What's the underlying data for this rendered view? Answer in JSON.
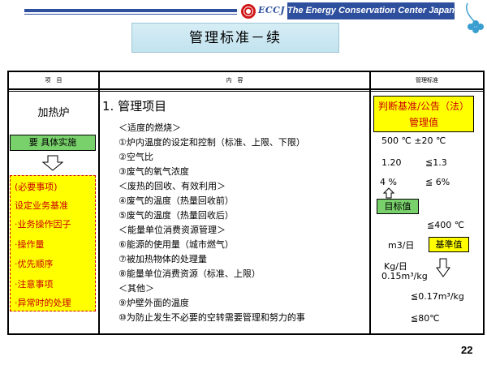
{
  "header": {
    "logo_text": "ECCJ",
    "org_name": "The Energy Conservation Center Japan",
    "title": "管理标准－续"
  },
  "table": {
    "headers": [
      "项　目",
      "内　容",
      "管理标准"
    ],
    "col1": {
      "label": "加热炉",
      "implement_label": "要 具体实施",
      "items": [
        "(必要事项)",
        "设定业务基准",
        "·业务操作因子",
        "·操作量",
        "·优先顺序",
        "·注意事项",
        "·异常时的处理"
      ]
    },
    "col2": {
      "title": "1. 管理项目",
      "lines": [
        "＜适度的燃烧＞",
        "①炉内温度的设定和控制（标准、上限、下限）",
        "②空气比",
        "③废气的氧气浓度",
        "＜废热的回收、有效利用＞",
        "④废气的温度（热量回收前）",
        "⑤废气的温度（热量回收后）",
        "＜能量单位消费资源管理＞",
        "⑥能源的使用量（城市燃气）",
        "⑦被加热物体的处理量",
        "⑧能量单位消费资源（标准、上限）",
        "＜其他＞",
        "⑨炉壁外面的温度",
        "⑩为防止发生不必要的空转需要管理和努力的事"
      ]
    },
    "col3": {
      "criteria_line1": "判断基准/公告（法）",
      "criteria_line2": "管理值",
      "temp": "500 ℃ ±20 ℃",
      "air_ratio_a": "1.20",
      "air_ratio_b": "≦1.3",
      "oxygen_a": "4 %",
      "oxygen_b": "≦ 6%",
      "target_label": "目标值",
      "exhaust_temp": "≦400 ℃",
      "unit_m3": "m3/日",
      "base_label": "基準值",
      "unit_kg": "Kg/日",
      "value_a": "0.15m³/kg",
      "value_b": "≦0.17m³/kg",
      "wall_temp": "≦80℃"
    }
  },
  "page_number": "22",
  "colors": {
    "brand_blue": "#2e4f9e",
    "yellow": "#ffff00",
    "green": "#79d16b",
    "red_text": "#cc0000"
  }
}
